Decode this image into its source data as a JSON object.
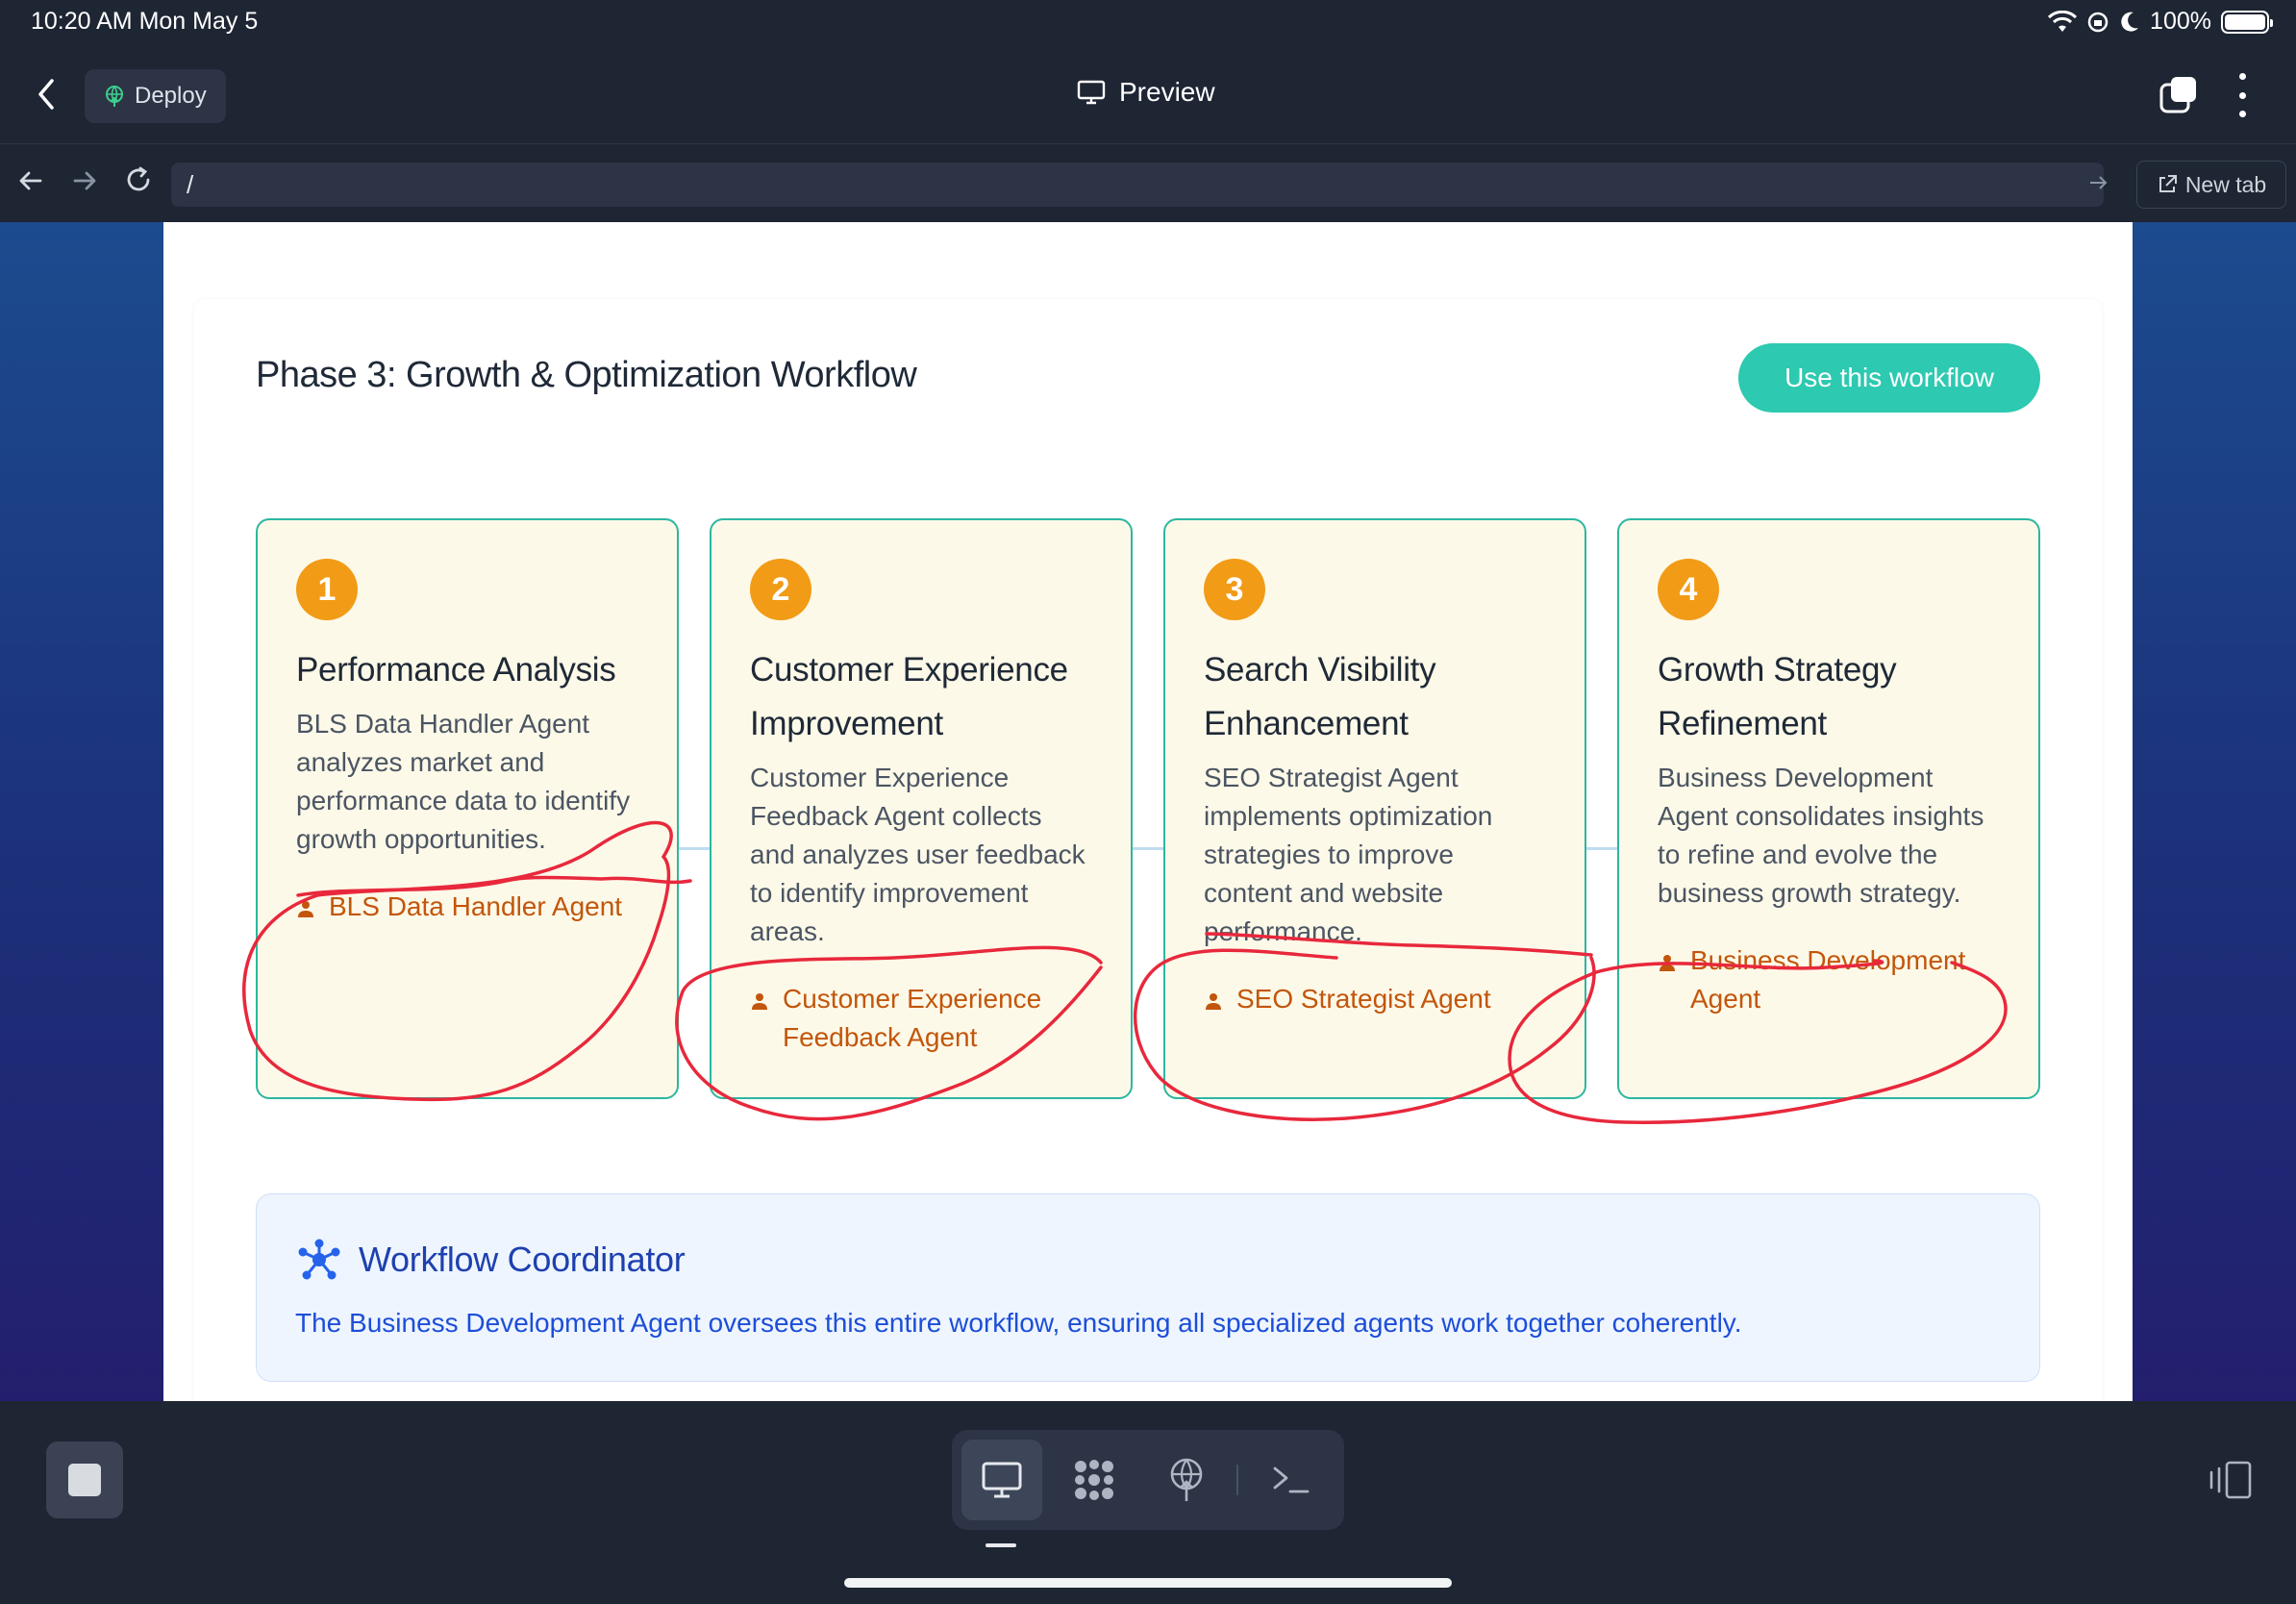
{
  "status_bar": {
    "time_date": "10:20 AM   Mon May 5",
    "battery": "100%"
  },
  "toolbar": {
    "deploy_label": "Deploy",
    "title": "Preview"
  },
  "address_bar": {
    "url": "/",
    "new_tab_label": "New tab"
  },
  "workflow": {
    "title": "Phase 3: Growth & Optimization Workflow",
    "use_button": "Use this workflow",
    "steps": [
      {
        "number": "1",
        "title": "Performance Analysis",
        "description": "BLS Data Handler Agent analyzes market and performance data to identify growth opportunities.",
        "agent": "BLS Data Handler Agent"
      },
      {
        "number": "2",
        "title": "Customer Experience Improvement",
        "description": "Customer Experience Feedback Agent collects and analyzes user feedback to identify improvement areas.",
        "agent": "Customer Experience Feedback Agent"
      },
      {
        "number": "3",
        "title": "Search Visibility Enhancement",
        "description": "SEO Strategist Agent implements optimization strategies to improve content and website performance.",
        "agent": "SEO Strategist Agent"
      },
      {
        "number": "4",
        "title": "Growth Strategy Refinement",
        "description": "Business Development Agent consolidates insights to refine and evolve the business growth strategy.",
        "agent": "Business Development Agent"
      }
    ],
    "coordinator": {
      "title": "Workflow Coordinator",
      "description": "The Business Development Agent oversees this entire workflow, ensuring all specialized agents work together coherently."
    }
  },
  "colors": {
    "accent_teal": "#2dc9b0",
    "step_orange": "#f29b16",
    "agent_text": "#c2560c",
    "annotation_red": "#e8283c",
    "coordinator_blue": "#1e40af"
  },
  "icons": {
    "deploy": "globe-upload-icon",
    "preview": "monitor-icon",
    "agent": "person-icon",
    "coordinator": "network-hub-icon",
    "dock": [
      "monitor-icon",
      "grid-dots-icon",
      "globe-upload-icon",
      "terminal-icon"
    ]
  }
}
